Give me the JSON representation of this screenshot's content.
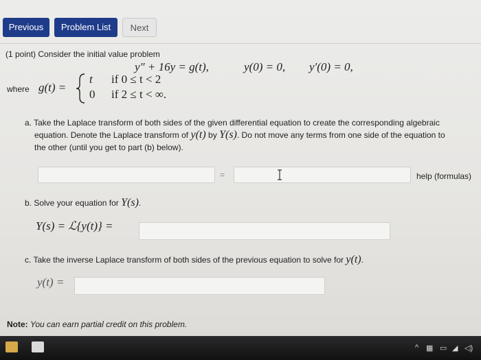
{
  "nav": {
    "previous": "Previous",
    "problem_list": "Problem List",
    "next": "Next"
  },
  "problem": {
    "intro": "(1 point) Consider the initial value problem",
    "equation": "y″ + 16y = g(t),",
    "ic1": "y(0) = 0,",
    "ic2": "y′(0) = 0,",
    "where": "where",
    "g_lhs": "g(t) =",
    "case1_val": "t",
    "case1_cond": "if 0 ≤ t < 2",
    "case2_val": "0",
    "case2_cond": "if 2 ≤ t < ∞."
  },
  "part_a": {
    "line1": "a. Take the Laplace transform of both sides of the given differential equation to create the corresponding algebraic",
    "line2_pre": "equation. Denote the Laplace transform of",
    "line2_y": "y(t)",
    "line2_by": "by",
    "line2_Y": "Y(s)",
    "line2_post": ". Do not move any terms from one side of the equation to",
    "line3": "the other (until you get to part (b) below).",
    "equals": "=",
    "help": "help (formulas)"
  },
  "part_b": {
    "prompt_pre": "b. Solve your equation for",
    "prompt_Y": "Y(s)",
    "prompt_post": ".",
    "lhs": "Y(s) = ℒ{y(t)} ="
  },
  "part_c": {
    "prompt_pre": "c. Take the inverse Laplace transform of both sides of the previous equation to solve for",
    "prompt_y": "y(t)",
    "prompt_post": ".",
    "lhs": "y(t) ="
  },
  "note": {
    "label": "Note:",
    "text": "You can earn partial credit on this problem."
  }
}
